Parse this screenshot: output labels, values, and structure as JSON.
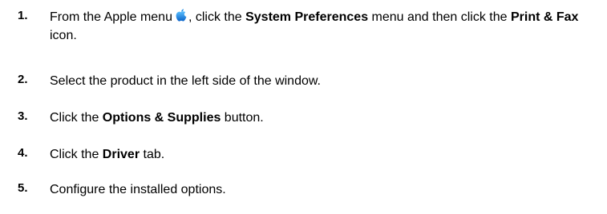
{
  "steps": [
    {
      "number": "1.",
      "text_a": "From the Apple menu",
      "icon": "apple-icon",
      "text_b": ", click the ",
      "bold_1": "System Preferences",
      "text_c": " menu and then click the ",
      "bold_2": "Print & Fax",
      "text_d": " icon."
    },
    {
      "number": "2.",
      "text": "Select the product in the left side of the window."
    },
    {
      "number": "3.",
      "text_a": "Click the ",
      "bold": "Options & Supplies",
      "text_b": " button."
    },
    {
      "number": "4.",
      "text_a": "Click the ",
      "bold": "Driver",
      "text_b": " tab."
    },
    {
      "number": "5.",
      "text": "Configure the installed options."
    }
  ],
  "colors": {
    "apple_icon": "#1f8fe6",
    "text": "#000000"
  }
}
